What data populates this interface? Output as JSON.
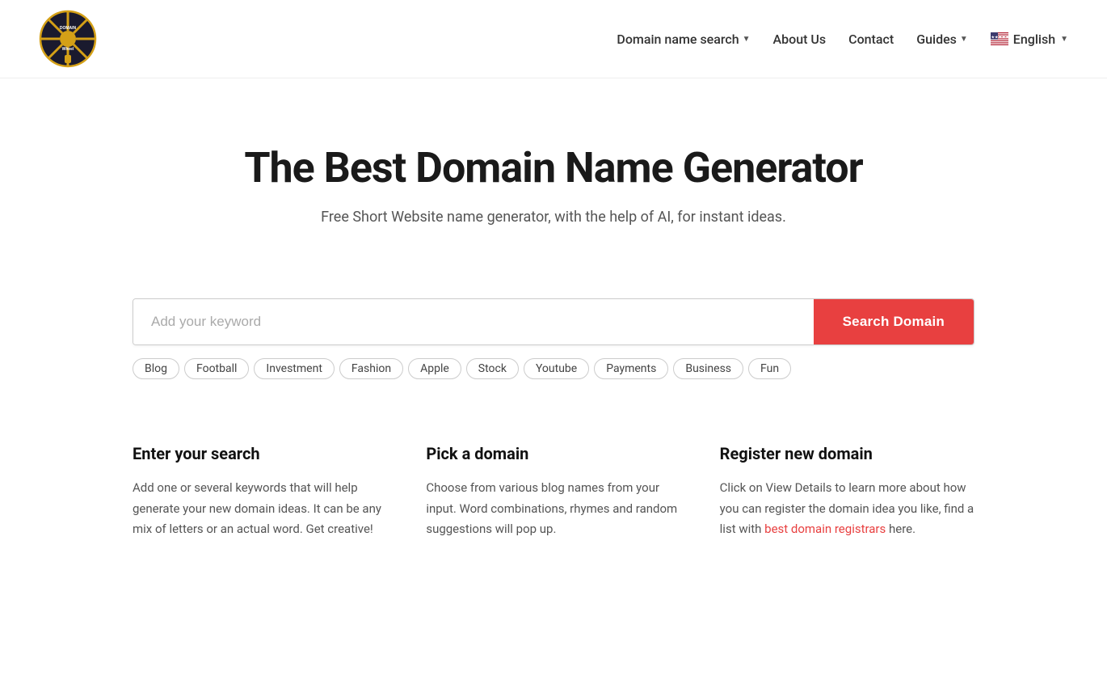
{
  "header": {
    "logo_alt": "Domain Wheel",
    "nav": {
      "domain_search_label": "Domain name search",
      "about_label": "About Us",
      "contact_label": "Contact",
      "guides_label": "Guides",
      "language_label": "English"
    }
  },
  "hero": {
    "title": "The Best Domain Name Generator",
    "subtitle": "Free Short Website name generator, with the help of AI, for instant ideas."
  },
  "search": {
    "placeholder": "Add your keyword",
    "button_label": "Search Domain"
  },
  "tags": [
    {
      "label": "Blog"
    },
    {
      "label": "Football"
    },
    {
      "label": "Investment"
    },
    {
      "label": "Fashion"
    },
    {
      "label": "Apple"
    },
    {
      "label": "Stock"
    },
    {
      "label": "Youtube"
    },
    {
      "label": "Payments"
    },
    {
      "label": "Business"
    },
    {
      "label": "Fun"
    }
  ],
  "features": [
    {
      "id": "enter-search",
      "title": "Enter your search",
      "body": "Add one or several keywords that will help generate your new domain ideas. It can be any mix of letters or an actual word. Get creative!"
    },
    {
      "id": "pick-domain",
      "title": "Pick a domain",
      "body": "Choose from various blog names from your input. Word combinations, rhymes and random suggestions will pop up."
    },
    {
      "id": "register-domain",
      "title": "Register new domain",
      "body_before_link": "Click on View Details to learn more about how you can register the domain idea you like, find a list with ",
      "link_text": "best domain registrars",
      "body_after_link": " here."
    }
  ]
}
